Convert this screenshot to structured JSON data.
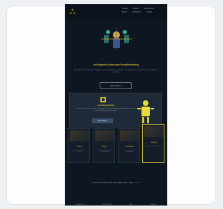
{
  "nav": {
    "links": [
      "HOME",
      "ABOUT",
      "FEATURES",
      "BLOG",
      "CONTACT",
      "LOGIN"
    ]
  },
  "hero": {
    "title": "Intelligente Autonome Kreativleistung",
    "subtitle": "Wir verbinden künstliche Intelligenz mit menschlicher Kreativität, um nachhaltige Lösungen für die Zukunft zu gestalten.",
    "button": "Mehr erfahren"
  },
  "banner": {
    "brand": "AutoNeuraPlanet",
    "text": "Entdecken Sie, wie unsere KI-gestützten Werkzeuge Ihre Arbeitsabläufe transformieren und neue Möglichkeiten eröffnen.",
    "button": "Jetzt starten"
  },
  "tiles": [
    {
      "title": "Analyse",
      "text": "Datenbasierte Einblicke in Echtzeit."
    },
    {
      "title": "Design",
      "text": "Kreative Konzepte mit KI-Unterstützung."
    },
    {
      "title": "Automation",
      "text": "Prozesse intelligent automatisieren."
    },
    {
      "title": "Support",
      "text": "Rund um die Uhr für Sie da."
    }
  ],
  "footer": {
    "title": "LA N E W  ZUKUNFT  PLANETARY  ERA  L L C",
    "links": [
      "IMPRESSUM",
      "DATENSCHUTZ",
      "AGB",
      "KONTAKT"
    ]
  },
  "colors": {
    "accent": "#d5b632",
    "background": "#0e1622"
  }
}
